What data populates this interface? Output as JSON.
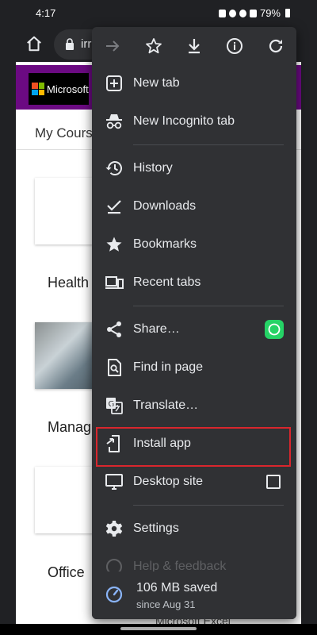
{
  "status_bar": {
    "time": "4:17",
    "battery": "79%"
  },
  "toolbar": {
    "url": "irr"
  },
  "page": {
    "brand": "Microsoft",
    "title": "My Cours",
    "sections": [
      "Health",
      "Manag",
      "Office"
    ],
    "bottom_caption": "Microsoft Excel"
  },
  "menu": {
    "top_actions": [
      "forward-icon",
      "bookmark-star-icon",
      "download-icon",
      "info-icon",
      "refresh-icon"
    ],
    "items": [
      {
        "label": "New tab",
        "icon": "new-tab-icon"
      },
      {
        "label": "New Incognito tab",
        "icon": "incognito-icon"
      },
      {
        "label": "History",
        "icon": "history-icon"
      },
      {
        "label": "Downloads",
        "icon": "downloads-icon"
      },
      {
        "label": "Bookmarks",
        "icon": "bookmarks-icon"
      },
      {
        "label": "Recent tabs",
        "icon": "recent-tabs-icon"
      },
      {
        "label": "Share…",
        "icon": "share-icon"
      },
      {
        "label": "Find in page",
        "icon": "find-in-page-icon"
      },
      {
        "label": "Translate…",
        "icon": "translate-icon"
      },
      {
        "label": "Install app",
        "icon": "install-app-icon"
      },
      {
        "label": "Desktop site",
        "icon": "desktop-site-icon"
      },
      {
        "label": "Settings",
        "icon": "settings-icon"
      },
      {
        "label": "Help & feedback",
        "icon": "help-icon"
      }
    ],
    "desktop_site_checked": false,
    "saved": {
      "amount": "106 MB saved",
      "since": "since Aug 31"
    }
  },
  "colors": {
    "menu_bg": "#303134",
    "highlight": "#d9262d",
    "accent": "#8ab4f8"
  }
}
